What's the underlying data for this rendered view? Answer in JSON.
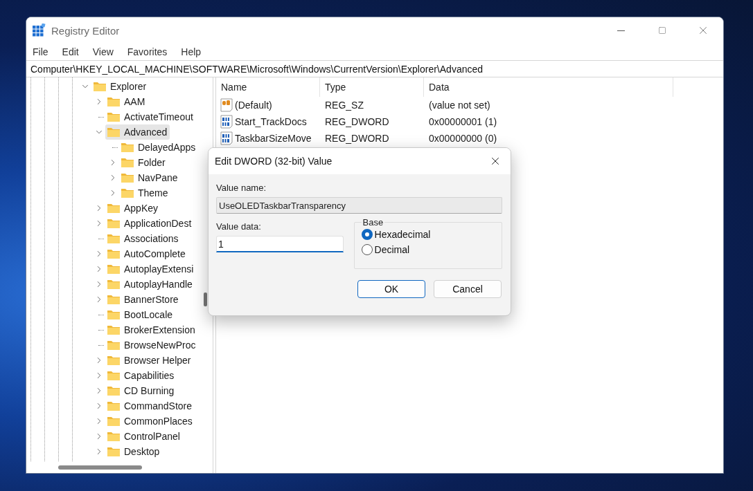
{
  "window": {
    "title": "Registry Editor"
  },
  "menu": [
    "File",
    "Edit",
    "View",
    "Favorites",
    "Help"
  ],
  "address": "Computer\\HKEY_LOCAL_MACHINE\\SOFTWARE\\Microsoft\\Windows\\CurrentVersion\\Explorer\\Advanced",
  "tree": [
    {
      "label": "Explorer",
      "kind": "branch",
      "expanded": true,
      "selected": false,
      "children": [
        {
          "label": "AAM",
          "kind": "branch",
          "expanded": false,
          "selected": false
        },
        {
          "label": "ActivateTimeout",
          "kind": "leaf",
          "selected": false
        },
        {
          "label": "Advanced",
          "kind": "branch",
          "expanded": true,
          "selected": true,
          "children": [
            {
              "label": "DelayedApps",
              "kind": "leaf",
              "selected": false
            },
            {
              "label": "Folder",
              "kind": "branch",
              "expanded": false,
              "selected": false
            },
            {
              "label": "NavPane",
              "kind": "branch",
              "expanded": false,
              "selected": false
            },
            {
              "label": "Theme",
              "kind": "branch",
              "expanded": false,
              "selected": false
            }
          ]
        },
        {
          "label": "AppKey",
          "kind": "branch",
          "expanded": false,
          "selected": false
        },
        {
          "label": "ApplicationDest",
          "kind": "branch",
          "expanded": false,
          "selected": false
        },
        {
          "label": "Associations",
          "kind": "leaf",
          "selected": false
        },
        {
          "label": "AutoComplete",
          "kind": "branch",
          "expanded": false,
          "selected": false
        },
        {
          "label": "AutoplayExtensi",
          "kind": "branch",
          "expanded": false,
          "selected": false
        },
        {
          "label": "AutoplayHandle",
          "kind": "branch",
          "expanded": false,
          "selected": false
        },
        {
          "label": "BannerStore",
          "kind": "branch",
          "expanded": false,
          "selected": false
        },
        {
          "label": "BootLocale",
          "kind": "leaf",
          "selected": false
        },
        {
          "label": "BrokerExtension",
          "kind": "leaf",
          "selected": false
        },
        {
          "label": "BrowseNewProc",
          "kind": "leaf",
          "selected": false
        },
        {
          "label": "Browser Helper",
          "kind": "branch",
          "expanded": false,
          "selected": false
        },
        {
          "label": "Capabilities",
          "kind": "branch",
          "expanded": false,
          "selected": false
        },
        {
          "label": "CD Burning",
          "kind": "branch",
          "expanded": false,
          "selected": false
        },
        {
          "label": "CommandStore",
          "kind": "branch",
          "expanded": false,
          "selected": false
        },
        {
          "label": "CommonPlaces",
          "kind": "branch",
          "expanded": false,
          "selected": false
        },
        {
          "label": "ControlPanel",
          "kind": "branch",
          "expanded": false,
          "selected": false
        },
        {
          "label": "Desktop",
          "kind": "branch",
          "expanded": false,
          "selected": false
        }
      ]
    }
  ],
  "values": {
    "columns": [
      "Name",
      "Type",
      "Data"
    ],
    "rows": [
      {
        "kind": "string",
        "name": "(Default)",
        "type": "REG_SZ",
        "data": "(value not set)"
      },
      {
        "kind": "binary",
        "name": "Start_TrackDocs",
        "type": "REG_DWORD",
        "data": "0x00000001 (1)"
      },
      {
        "kind": "binary",
        "name": "TaskbarSizeMove",
        "type": "REG_DWORD",
        "data": "0x00000000 (0)"
      }
    ]
  },
  "dialog": {
    "title": "Edit DWORD (32-bit) Value",
    "value_name_label": "Value name:",
    "value_name": "UseOLEDTaskbarTransparency",
    "value_data_label": "Value data:",
    "value_data": "1",
    "base_label": "Base",
    "bases": [
      {
        "label": "Hexadecimal",
        "selected": true
      },
      {
        "label": "Decimal",
        "selected": false
      }
    ],
    "buttons": [
      {
        "label": "OK",
        "default": true
      },
      {
        "label": "Cancel",
        "default": false
      }
    ]
  }
}
